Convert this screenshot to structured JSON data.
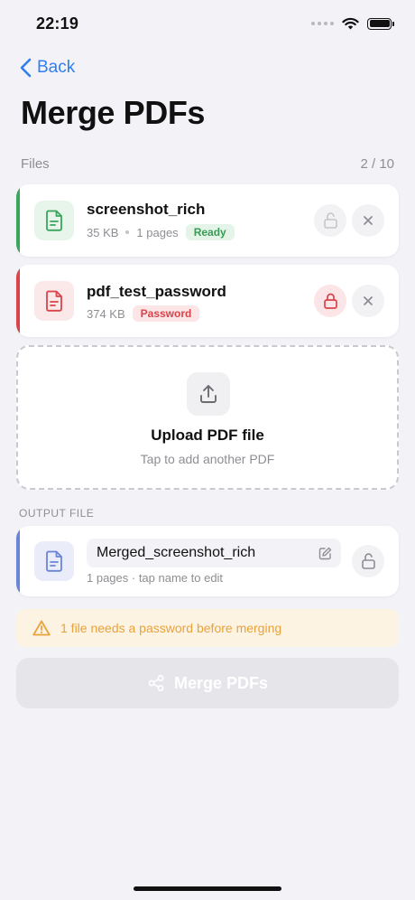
{
  "status_bar": {
    "time": "22:19"
  },
  "nav": {
    "back_label": "Back"
  },
  "page": {
    "title": "Merge PDFs"
  },
  "files_section": {
    "label": "Files",
    "count": "2 / 10"
  },
  "files": [
    {
      "name": "screenshot_rich",
      "size": "35 KB",
      "pages": "1 pages",
      "badge": "Ready",
      "status": "ready",
      "icon": "document-icon",
      "lock_icon": "unlock-icon",
      "accent_color": "#3aa55c"
    },
    {
      "name": "pdf_test_password",
      "size": "374 KB",
      "badge": "Password",
      "status": "password",
      "icon": "document-icon",
      "lock_icon": "lock-icon",
      "accent_color": "#d9434a"
    }
  ],
  "upload": {
    "title": "Upload PDF file",
    "subtitle": "Tap to add another PDF",
    "icon": "upload-icon"
  },
  "output": {
    "section_label": "OUTPUT FILE",
    "file_name": "Merged_screenshot_rich",
    "meta": "1 pages · tap name to edit",
    "accent_color": "#6a84d8",
    "icon": "document-icon",
    "edit_icon": "edit-icon",
    "lock_icon": "unlock-icon"
  },
  "warning": {
    "text": "1 file needs a password before merging",
    "icon": "warning-icon",
    "color": "#e8a23a"
  },
  "merge_button": {
    "label": "Merge PDFs",
    "icon": "share-nodes-icon",
    "enabled": false
  }
}
